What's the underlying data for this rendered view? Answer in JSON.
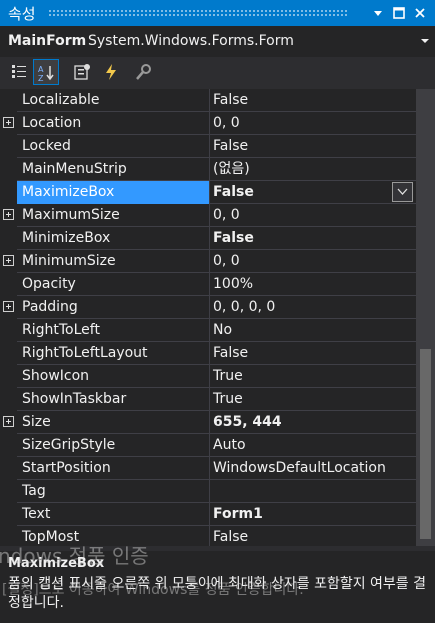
{
  "panel": {
    "title": "속성"
  },
  "object": {
    "name": "MainForm",
    "type": "System.Windows.Forms.Form"
  },
  "toolbar": {
    "tools": [
      "categorized-icon",
      "alphabetical-icon",
      "properties-icon",
      "events-icon",
      "property-pages-icon"
    ],
    "active": "alphabetical-icon"
  },
  "properties": [
    {
      "name": "Localizable",
      "value": "False"
    },
    {
      "name": "Location",
      "value": "0, 0",
      "expandable": true
    },
    {
      "name": "Locked",
      "value": "False"
    },
    {
      "name": "MainMenuStrip",
      "value": "(없음)"
    },
    {
      "name": "MaximizeBox",
      "value": "False",
      "selected": true,
      "bold": true
    },
    {
      "name": "MaximumSize",
      "value": "0, 0",
      "expandable": true
    },
    {
      "name": "MinimizeBox",
      "value": "False",
      "bold": true
    },
    {
      "name": "MinimumSize",
      "value": "0, 0",
      "expandable": true
    },
    {
      "name": "Opacity",
      "value": "100%"
    },
    {
      "name": "Padding",
      "value": "0, 0, 0, 0",
      "expandable": true
    },
    {
      "name": "RightToLeft",
      "value": "No"
    },
    {
      "name": "RightToLeftLayout",
      "value": "False"
    },
    {
      "name": "ShowIcon",
      "value": "True"
    },
    {
      "name": "ShowInTaskbar",
      "value": "True"
    },
    {
      "name": "Size",
      "value": "655, 444",
      "expandable": true,
      "bold": true
    },
    {
      "name": "SizeGripStyle",
      "value": "Auto"
    },
    {
      "name": "StartPosition",
      "value": "WindowsDefaultLocation"
    },
    {
      "name": "Tag",
      "value": ""
    },
    {
      "name": "Text",
      "value": "Form1",
      "bold": true
    },
    {
      "name": "TopMost",
      "value": "False"
    }
  ],
  "description": {
    "title": "MaximizeBox",
    "text": "폼의 캡션 표시줄 오른쪽 위 모퉁이에 최대화 상자를 포함할지 여부를 결정합니다."
  },
  "watermark": {
    "line1": "ndows 정품 인증",
    "line2": "[설정]으로 이동하여 Windows를 정품 인증합니다."
  },
  "colors": {
    "accent": "#007acc",
    "selection": "#3399ff",
    "background": "#252526"
  }
}
